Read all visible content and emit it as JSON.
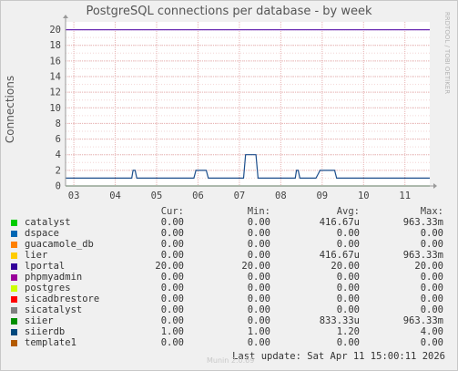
{
  "chart_data": {
    "type": "line",
    "title": "PostgreSQL connections per database - by week",
    "ylabel": "Connections",
    "xlabel": "",
    "ylim": [
      0,
      21
    ],
    "xlim": [
      0,
      8.8
    ],
    "yticks": [
      0,
      2,
      4,
      6,
      8,
      10,
      12,
      14,
      16,
      18,
      20
    ],
    "xtick_labels": [
      "03",
      "04",
      "05",
      "06",
      "07",
      "08",
      "09",
      "10",
      "11"
    ],
    "xtick_values": [
      0.2,
      1.2,
      2.2,
      3.2,
      4.2,
      5.2,
      6.2,
      7.2,
      8.2
    ],
    "grid": true,
    "series": [
      {
        "name": "lportal",
        "color": "#6a2bb3",
        "points": [
          [
            0,
            20
          ],
          [
            8.8,
            20
          ]
        ]
      },
      {
        "name": "siierdb",
        "color": "#1c4e8c",
        "points": [
          [
            0,
            1
          ],
          [
            1.6,
            1
          ],
          [
            1.63,
            2
          ],
          [
            1.68,
            2
          ],
          [
            1.72,
            1
          ],
          [
            3.1,
            1
          ],
          [
            3.15,
            2
          ],
          [
            3.4,
            2
          ],
          [
            3.45,
            1
          ],
          [
            4.3,
            1
          ],
          [
            4.35,
            4
          ],
          [
            4.6,
            4
          ],
          [
            4.65,
            1
          ],
          [
            5.55,
            1
          ],
          [
            5.58,
            2
          ],
          [
            5.62,
            2
          ],
          [
            5.66,
            1
          ],
          [
            6.05,
            1
          ],
          [
            6.1,
            1.5
          ],
          [
            6.15,
            2
          ],
          [
            6.5,
            2
          ],
          [
            6.55,
            1
          ],
          [
            8.8,
            1
          ]
        ]
      },
      {
        "name": "siier",
        "color": "#1a7d1a",
        "points": [
          [
            0,
            0
          ],
          [
            8.8,
            0
          ]
        ]
      }
    ]
  },
  "legend": {
    "headers": [
      "Cur:",
      "Min:",
      "Avg:",
      "Max:"
    ],
    "rows": [
      {
        "name": "catalyst",
        "color": "#00cc00",
        "cur": "0.00",
        "min": "0.00",
        "avg": "416.67u",
        "max": "963.33m"
      },
      {
        "name": "dspace",
        "color": "#0066b3",
        "cur": "0.00",
        "min": "0.00",
        "avg": "0.00",
        "max": "0.00"
      },
      {
        "name": "guacamole_db",
        "color": "#ff8000",
        "cur": "0.00",
        "min": "0.00",
        "avg": "0.00",
        "max": "0.00"
      },
      {
        "name": "lier",
        "color": "#ffcc00",
        "cur": "0.00",
        "min": "0.00",
        "avg": "416.67u",
        "max": "963.33m"
      },
      {
        "name": "lportal",
        "color": "#330099",
        "cur": "20.00",
        "min": "20.00",
        "avg": "20.00",
        "max": "20.00"
      },
      {
        "name": "phpmyadmin",
        "color": "#990099",
        "cur": "0.00",
        "min": "0.00",
        "avg": "0.00",
        "max": "0.00"
      },
      {
        "name": "postgres",
        "color": "#ccff00",
        "cur": "0.00",
        "min": "0.00",
        "avg": "0.00",
        "max": "0.00"
      },
      {
        "name": "sicadbrestore",
        "color": "#ff0000",
        "cur": "0.00",
        "min": "0.00",
        "avg": "0.00",
        "max": "0.00"
      },
      {
        "name": "sicatalyst",
        "color": "#808080",
        "cur": "0.00",
        "min": "0.00",
        "avg": "0.00",
        "max": "0.00"
      },
      {
        "name": "siier",
        "color": "#008f00",
        "cur": "0.00",
        "min": "0.00",
        "avg": "833.33u",
        "max": "963.33m"
      },
      {
        "name": "siierdb",
        "color": "#00487d",
        "cur": "1.00",
        "min": "1.00",
        "avg": "1.20",
        "max": "4.00"
      },
      {
        "name": "template1",
        "color": "#b35a00",
        "cur": "0.00",
        "min": "0.00",
        "avg": "0.00",
        "max": "0.00"
      }
    ]
  },
  "last_update": "Last update:  Sat Apr 11 15:00:11 2026",
  "watermark": "RRDTOOL / TOBI OETIKER",
  "footer": "Munin 2.0.69"
}
